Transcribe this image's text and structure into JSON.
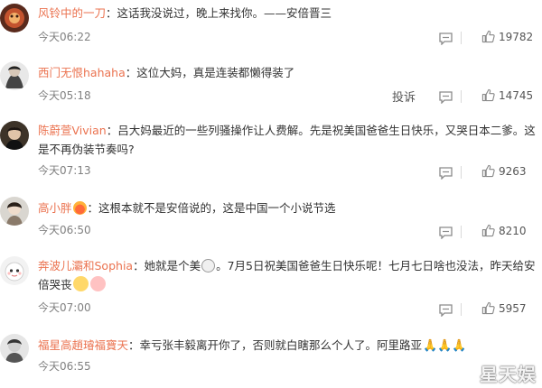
{
  "comments": [
    {
      "user": "风铃中的一刀",
      "text": "：这话我没说过，晚上来找你。——安倍晋三",
      "time": "今天06:22",
      "likes": "19782"
    },
    {
      "user": "西门无恨hahaha",
      "text": "：这位大妈，真是连装都懒得装了",
      "time": "今天05:18",
      "report": "投诉",
      "likes": "14745"
    },
    {
      "user": "陈蔚萱Vivian",
      "text": "：吕大妈最近的一些列骚操作让人费解。先是祝美国爸爸生日快乐，又哭日本二爹。这是不再伪装节奏吗?",
      "time": "今天07:13",
      "likes": "9263"
    },
    {
      "user": "高小胖",
      "text": "：这根本就不是安倍说的，这是中国一个小说节选",
      "time": "今天06:50",
      "likes": "8210"
    },
    {
      "user": "奔波儿灞和Sophia",
      "text_a": "：她就是个美",
      "text_b": "。7月5日祝美国爸爸生日快乐呢！七月七日啥也没法，昨天给安倍哭丧",
      "time": "今天07:00",
      "likes": "5957"
    },
    {
      "user": "福星高趙璿福寶天",
      "text": "：幸亏张丰毅离开你了，否则就白瞎那么个人了。阿里路亚",
      "time": "今天06:55"
    }
  ],
  "watermark": "星天娱",
  "icons": {
    "reply": "comment-bubble-icon",
    "like": "thumbs-up-icon",
    "pray": "praying-hands-emoji"
  },
  "colors": {
    "username": "#eb7350",
    "text": "#333333",
    "meta": "#808080"
  }
}
